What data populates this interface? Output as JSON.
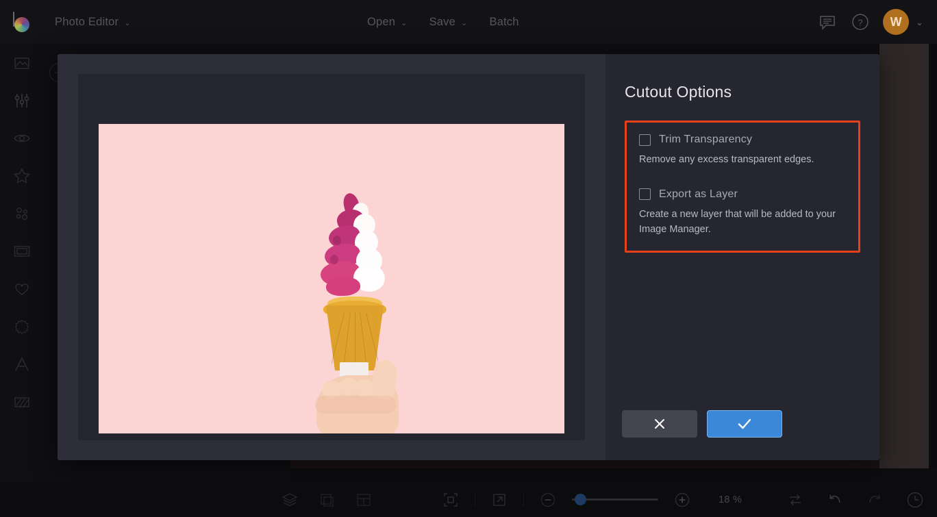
{
  "app": {
    "name": "Photo Editor",
    "logo_icon": "color-wheel-logo"
  },
  "topbar": {
    "app_menu_label": "Photo Editor",
    "app_menu_caret": "⌄",
    "center_menus": [
      {
        "label": "Open",
        "has_caret": true
      },
      {
        "label": "Save",
        "has_caret": true
      },
      {
        "label": "Batch",
        "has_caret": false
      }
    ],
    "feedback_icon": "chat-bubble-icon",
    "help_icon": "question-mark-circle-icon",
    "avatar_initial": "W",
    "avatar_color": "#b0701f",
    "avatar_caret": "⌄"
  },
  "sidebar": {
    "items": [
      {
        "name": "image",
        "icon": "image-icon"
      },
      {
        "name": "adjust",
        "icon": "sliders-icon"
      },
      {
        "name": "retouch",
        "icon": "eye-icon"
      },
      {
        "name": "effects",
        "icon": "star-icon"
      },
      {
        "name": "overlays",
        "icon": "particles-icon"
      },
      {
        "name": "frames",
        "icon": "frame-icon"
      },
      {
        "name": "stickers",
        "icon": "heart-icon"
      },
      {
        "name": "badges",
        "icon": "sunburst-icon"
      },
      {
        "name": "text",
        "icon": "letter-a-icon"
      },
      {
        "name": "texture",
        "icon": "diagonal-stripes-icon"
      }
    ]
  },
  "background_actions": {
    "cancel_icon": "close-x-icon",
    "apply_icon": "check-icon"
  },
  "modal": {
    "preview": {
      "image_alt": "hand holding a pink and white swirl soft-serve ice cream cone on a pink background",
      "background_color": "#fdd4d4"
    },
    "title": "Cutout Options",
    "highlight_color": "#e8401a",
    "options": [
      {
        "label": "Trim Transparency",
        "description": "Remove any excess transparent edges.",
        "checked": false
      },
      {
        "label": "Export as Layer",
        "description": "Create a new layer that will be added to your Image Manager.",
        "checked": false
      }
    ],
    "actions": {
      "cancel_icon": "close-x-icon",
      "confirm_icon": "check-icon",
      "confirm_color": "#3c88d8"
    }
  },
  "bottombar": {
    "left_icons": [
      {
        "name": "layers",
        "icon": "layers-icon"
      },
      {
        "name": "crop",
        "icon": "crop-icon"
      },
      {
        "name": "layout",
        "icon": "layout-grid-icon"
      }
    ],
    "mid_icons": [
      {
        "name": "fit-to-screen",
        "icon": "fit-frame-icon"
      },
      {
        "name": "fullscreen",
        "icon": "expand-arrow-icon"
      }
    ],
    "zoom_out_icon": "minus-circle-icon",
    "zoom_in_icon": "plus-circle-icon",
    "zoom_value": "18 %",
    "zoom_slider_percent": 18,
    "right_icons": [
      {
        "name": "compare",
        "icon": "swap-arrows-icon"
      },
      {
        "name": "undo",
        "icon": "undo-arrow-icon"
      },
      {
        "name": "redo",
        "icon": "redo-arrow-icon"
      },
      {
        "name": "history",
        "icon": "clock-icon"
      }
    ]
  }
}
